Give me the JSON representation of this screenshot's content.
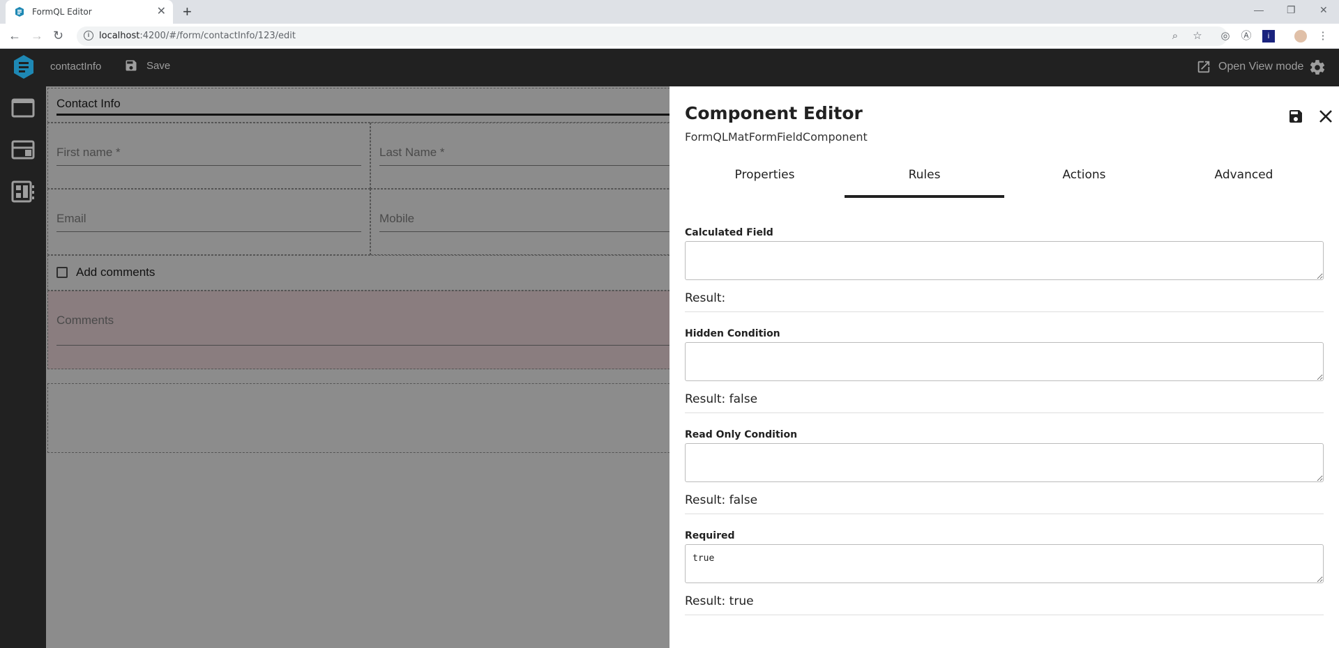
{
  "browser": {
    "tab_title": "FormQL Editor",
    "url_host": "localhost",
    "url_path": ":4200/#/form/contactInfo/123/edit"
  },
  "appbar": {
    "form_name": "contactInfo",
    "save_label": "Save",
    "view_mode_label": "Open View mode"
  },
  "form": {
    "section_title": "Contact Info",
    "first_name_placeholder": "First name *",
    "last_name_placeholder": "Last Name *",
    "email_placeholder": "Email",
    "mobile_placeholder": "Mobile",
    "add_comments_label": "Add comments",
    "comments_placeholder": "Comments"
  },
  "editor": {
    "title": "Component Editor",
    "subtitle": "FormQLMatFormFieldComponent",
    "tabs": [
      "Properties",
      "Rules",
      "Actions",
      "Advanced"
    ],
    "active_tab": "Rules",
    "rules": [
      {
        "label": "Calculated Field",
        "value": "",
        "result": "Result:"
      },
      {
        "label": "Hidden Condition",
        "value": "",
        "result": "Result: false"
      },
      {
        "label": "Read Only Condition",
        "value": "",
        "result": "Result: false"
      },
      {
        "label": "Required",
        "value": "true",
        "result": "Result: true"
      }
    ]
  },
  "colors": {
    "appbar_bg": "#212121",
    "logo_accent": "#1e88b4",
    "comments_bg": "#fbe3e8"
  }
}
